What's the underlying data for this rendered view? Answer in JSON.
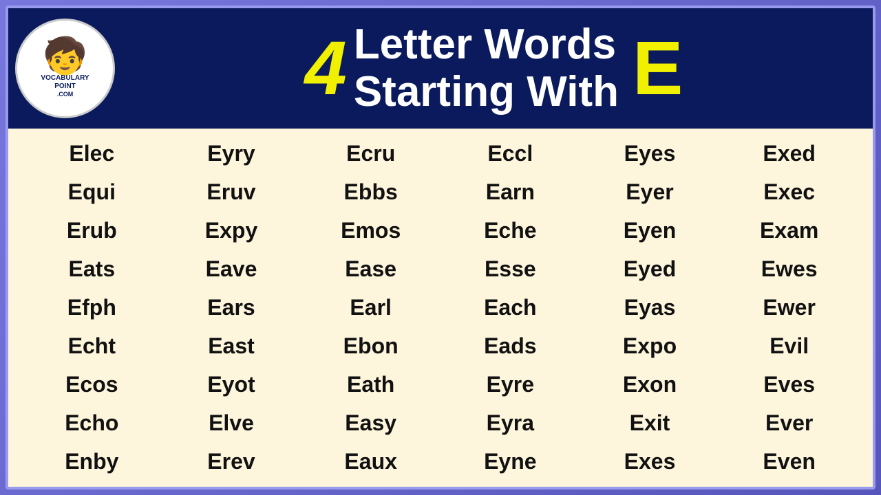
{
  "header": {
    "logo": {
      "mascot": "🧑",
      "line1": "VOCABULARY",
      "line2": "POINT",
      "line3": ".COM"
    },
    "number": "4",
    "title_line1": "Letter Words",
    "title_line2": "Starting With",
    "letter": "E"
  },
  "words": [
    "Elec",
    "Eyry",
    "Ecru",
    "Eccl",
    "Eyes",
    "Exed",
    "Equi",
    "Eruv",
    "Ebbs",
    "Earn",
    "Eyer",
    "Exec",
    "Erub",
    "Expy",
    "Emos",
    "Eche",
    "Eyen",
    "Exam",
    "Eats",
    "Eave",
    "Ease",
    "Esse",
    "Eyed",
    "Ewes",
    "Efph",
    "Ears",
    "Earl",
    "Each",
    "Eyas",
    "Ewer",
    "Echt",
    "East",
    "Ebon",
    "Eads",
    "Expo",
    "Evil",
    "Ecos",
    "Eyot",
    "Eath",
    "Eyre",
    "Exon",
    "Eves",
    "Echo",
    "Elve",
    "Easy",
    "Eyra",
    "Exit",
    "Ever",
    "Enby",
    "Erev",
    "Eaux",
    "Eyne",
    "Exes",
    "Even"
  ]
}
